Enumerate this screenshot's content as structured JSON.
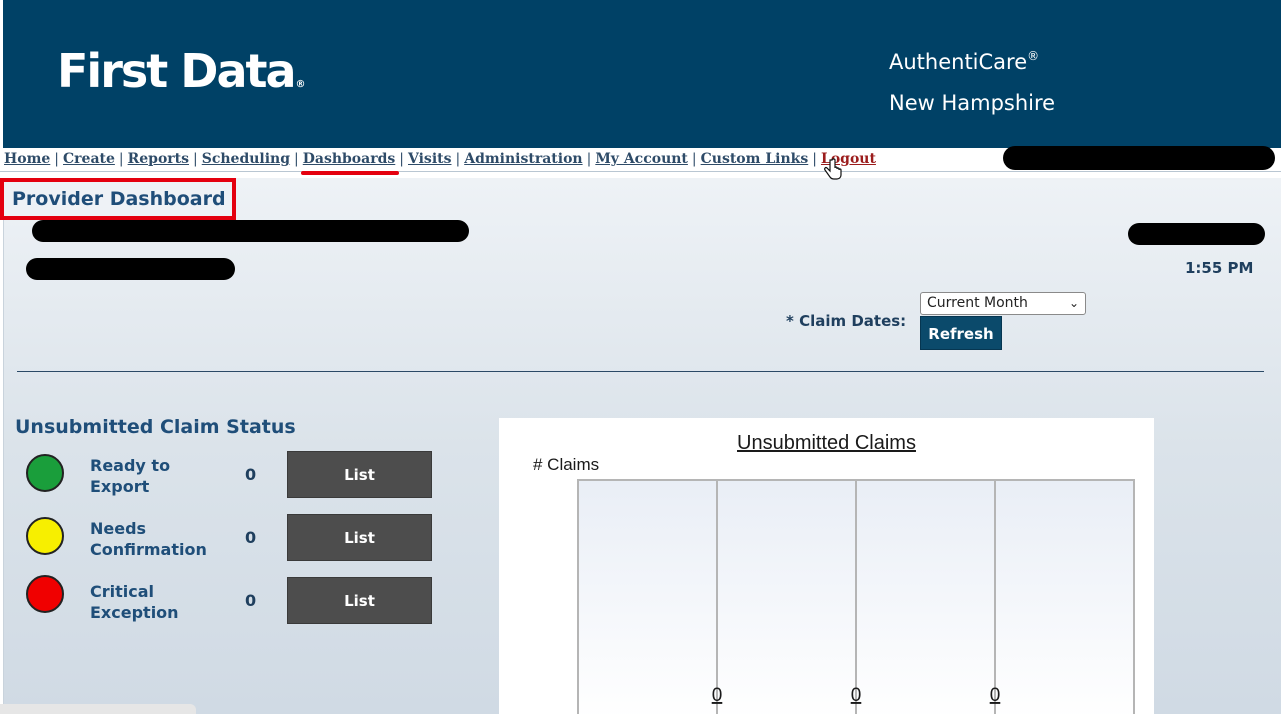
{
  "header": {
    "logo_text": "First Data",
    "logo_mark": "®",
    "brand_line1": "AuthentiCare",
    "brand_reg": "®",
    "brand_line2": "New Hampshire"
  },
  "nav": {
    "items": [
      "Home",
      "Create",
      "Reports",
      "Scheduling",
      "Dashboards",
      "Visits",
      "Administration",
      "My Account",
      "Custom Links",
      "Logout"
    ],
    "active": "Dashboards"
  },
  "page": {
    "title": "Provider Dashboard",
    "time": "1:55 PM"
  },
  "filters": {
    "claim_dates_label": "* Claim Dates:",
    "claim_dates_value": "Current Month",
    "refresh_label": "Refresh"
  },
  "status": {
    "title": "Unsubmitted Claim Status",
    "rows": [
      {
        "name_line1": "Ready to",
        "name_line2": "Export",
        "count": "0",
        "button": "List",
        "color": "#1a9e3b"
      },
      {
        "name_line1": "Needs",
        "name_line2": "Confirmation",
        "count": "0",
        "button": "List",
        "color": "#f7ef00"
      },
      {
        "name_line1": "Critical",
        "name_line2": "Exception",
        "count": "0",
        "button": "List",
        "color": "#f00000"
      }
    ]
  },
  "chart_data": {
    "type": "bar",
    "title": "Unsubmitted Claims",
    "ylabel": "# Claims",
    "xlabel": "",
    "series": [
      {
        "values": [
          0,
          0,
          0
        ]
      }
    ],
    "data_labels": [
      "0",
      "0",
      "0"
    ],
    "grid": true
  },
  "colors": {
    "header_bg": "#004166",
    "accent_red": "#e4000f",
    "nav_text": "#2e4b68"
  }
}
